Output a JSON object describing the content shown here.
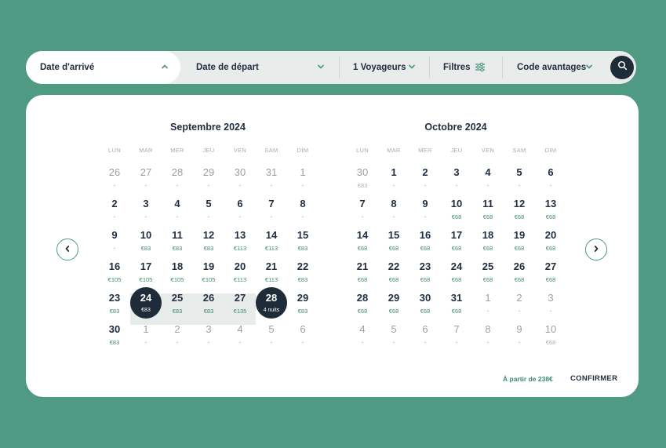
{
  "search_bar": {
    "arrival_label": "Date d'arrivé",
    "departure_label": "Date de départ",
    "travellers_label": "1 Voyageurs",
    "filters_label": "Filtres",
    "promo_label": "Code avantages",
    "accent_color": "#4e9a83",
    "icons": [
      "chevron-up-icon",
      "chevron-down-icon",
      "filter-sliders-icon",
      "search-icon"
    ]
  },
  "weekdays": [
    "LUN",
    "MAR",
    "MER",
    "JEU",
    "VEN",
    "SAM",
    "DIM"
  ],
  "months": [
    {
      "title": "Septembre 2024",
      "weeks": [
        [
          {
            "n": "26",
            "p": "-",
            "o": true
          },
          {
            "n": "27",
            "p": "-",
            "o": true
          },
          {
            "n": "28",
            "p": "-",
            "o": true
          },
          {
            "n": "29",
            "p": "-",
            "o": true
          },
          {
            "n": "30",
            "p": "-",
            "o": true
          },
          {
            "n": "31",
            "p": "-",
            "o": true
          },
          {
            "n": "1",
            "p": "-",
            "o": true
          }
        ],
        [
          {
            "n": "2",
            "p": "-"
          },
          {
            "n": "3",
            "p": "-"
          },
          {
            "n": "4",
            "p": "-"
          },
          {
            "n": "5",
            "p": "-"
          },
          {
            "n": "6",
            "p": "-"
          },
          {
            "n": "7",
            "p": "-"
          },
          {
            "n": "8",
            "p": "-"
          }
        ],
        [
          {
            "n": "9",
            "p": "-"
          },
          {
            "n": "10",
            "p": "€83"
          },
          {
            "n": "11",
            "p": "€83"
          },
          {
            "n": "12",
            "p": "€83"
          },
          {
            "n": "13",
            "p": "€113"
          },
          {
            "n": "14",
            "p": "€113"
          },
          {
            "n": "15",
            "p": "€83"
          }
        ],
        [
          {
            "n": "16",
            "p": "€105"
          },
          {
            "n": "17",
            "p": "€105"
          },
          {
            "n": "18",
            "p": "€105"
          },
          {
            "n": "19",
            "p": "€105"
          },
          {
            "n": "20",
            "p": "€113"
          },
          {
            "n": "21",
            "p": "€113"
          },
          {
            "n": "22",
            "p": "€83"
          }
        ],
        [
          {
            "n": "23",
            "p": "€83"
          },
          {
            "n": "24",
            "p": "€83",
            "s": true
          },
          {
            "n": "25",
            "p": "€83",
            "r": true
          },
          {
            "n": "26",
            "p": "€83",
            "r": true
          },
          {
            "n": "27",
            "p": "€135",
            "r": true
          },
          {
            "n": "28",
            "p": "4 nuits",
            "s": true
          },
          {
            "n": "29",
            "p": "€83"
          }
        ],
        [
          {
            "n": "30",
            "p": "€83"
          },
          {
            "n": "1",
            "p": "-",
            "o": true
          },
          {
            "n": "2",
            "p": "-",
            "o": true
          },
          {
            "n": "3",
            "p": "-",
            "o": true
          },
          {
            "n": "4",
            "p": "-",
            "o": true
          },
          {
            "n": "5",
            "p": "-",
            "o": true
          },
          {
            "n": "6",
            "p": "-",
            "o": true
          }
        ]
      ]
    },
    {
      "title": "Octobre 2024",
      "weeks": [
        [
          {
            "n": "30",
            "p": "€83",
            "o": true
          },
          {
            "n": "1",
            "p": "-"
          },
          {
            "n": "2",
            "p": "-"
          },
          {
            "n": "3",
            "p": "-"
          },
          {
            "n": "4",
            "p": "-"
          },
          {
            "n": "5",
            "p": "-"
          },
          {
            "n": "6",
            "p": "-"
          }
        ],
        [
          {
            "n": "7",
            "p": "-"
          },
          {
            "n": "8",
            "p": "-"
          },
          {
            "n": "9",
            "p": "-"
          },
          {
            "n": "10",
            "p": "€68"
          },
          {
            "n": "11",
            "p": "€68"
          },
          {
            "n": "12",
            "p": "€68"
          },
          {
            "n": "13",
            "p": "€68"
          }
        ],
        [
          {
            "n": "14",
            "p": "€68"
          },
          {
            "n": "15",
            "p": "€68"
          },
          {
            "n": "16",
            "p": "€68"
          },
          {
            "n": "17",
            "p": "€68"
          },
          {
            "n": "18",
            "p": "€68"
          },
          {
            "n": "19",
            "p": "€68"
          },
          {
            "n": "20",
            "p": "€68"
          }
        ],
        [
          {
            "n": "21",
            "p": "€68"
          },
          {
            "n": "22",
            "p": "€68"
          },
          {
            "n": "23",
            "p": "€68"
          },
          {
            "n": "24",
            "p": "€68"
          },
          {
            "n": "25",
            "p": "€68"
          },
          {
            "n": "26",
            "p": "€68"
          },
          {
            "n": "27",
            "p": "€68"
          }
        ],
        [
          {
            "n": "28",
            "p": "€68"
          },
          {
            "n": "29",
            "p": "€68"
          },
          {
            "n": "30",
            "p": "€68"
          },
          {
            "n": "31",
            "p": "€68"
          },
          {
            "n": "1",
            "p": "-",
            "o": true
          },
          {
            "n": "2",
            "p": "-",
            "o": true
          },
          {
            "n": "3",
            "p": "-",
            "o": true
          }
        ],
        [
          {
            "n": "4",
            "p": "-",
            "o": true
          },
          {
            "n": "5",
            "p": "-",
            "o": true
          },
          {
            "n": "6",
            "p": "-",
            "o": true
          },
          {
            "n": "7",
            "p": "-",
            "o": true
          },
          {
            "n": "8",
            "p": "-",
            "o": true
          },
          {
            "n": "9",
            "p": "-",
            "o": true
          },
          {
            "n": "10",
            "p": "€68",
            "o": true
          }
        ]
      ]
    }
  ],
  "footer": {
    "price_text": "À partir de 238€",
    "confirm_label": "CONFIRMER"
  }
}
